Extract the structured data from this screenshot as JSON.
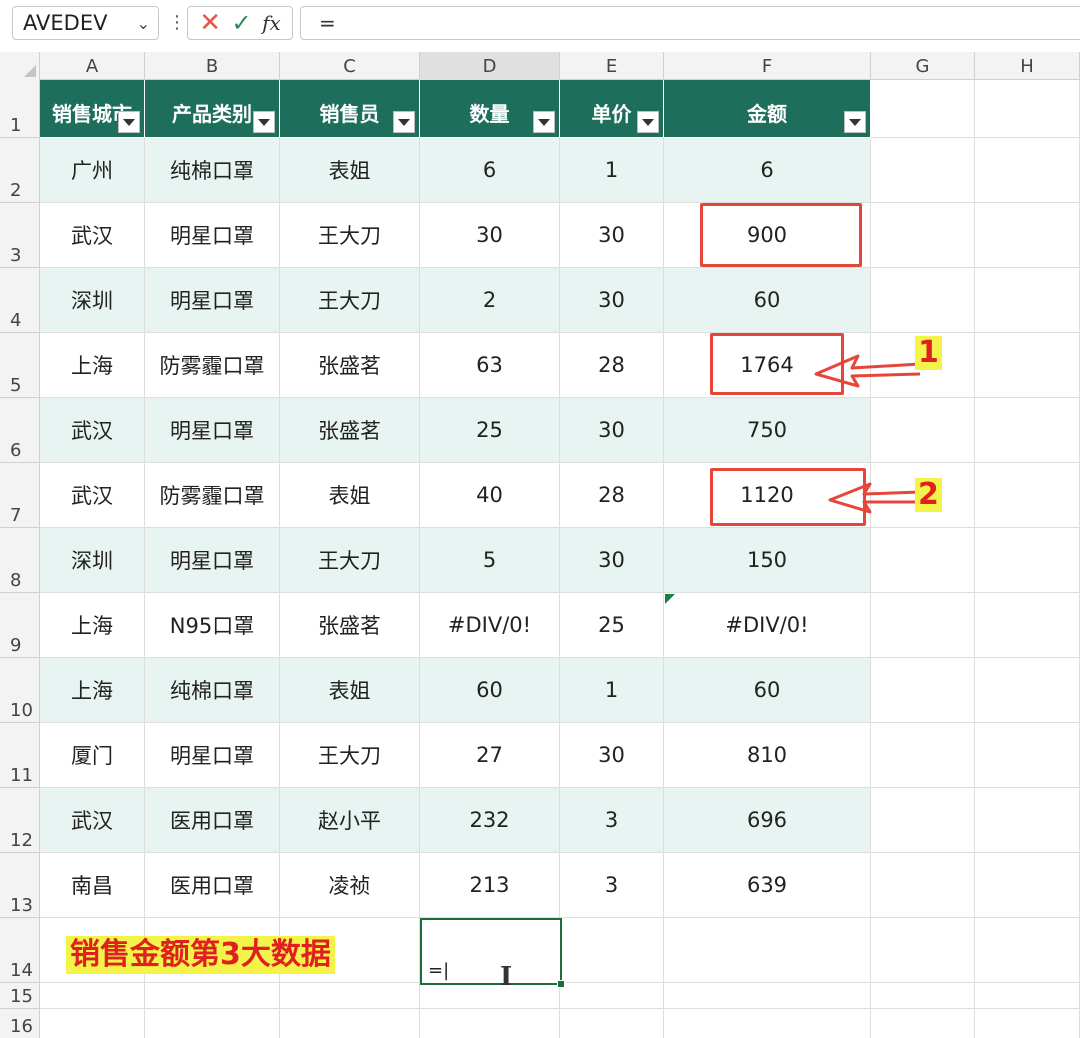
{
  "formula_bar": {
    "name_box": "AVEDEV",
    "separator": "⋮",
    "cancel_icon": "✕",
    "enter_icon": "✓",
    "fx_label": "fx",
    "formula": "="
  },
  "columns": [
    "A",
    "B",
    "C",
    "D",
    "E",
    "F",
    "G",
    "H"
  ],
  "rows": [
    "1",
    "2",
    "3",
    "4",
    "5",
    "6",
    "7",
    "8",
    "9",
    "10",
    "11",
    "12",
    "13",
    "14",
    "15",
    "16"
  ],
  "table": {
    "headers": [
      "销售城市",
      "产品类别",
      "销售员",
      "数量",
      "单价",
      "金额"
    ],
    "data": [
      [
        "广州",
        "纯棉口罩",
        "表姐",
        "6",
        "1",
        "6"
      ],
      [
        "武汉",
        "明星口罩",
        "王大刀",
        "30",
        "30",
        "900"
      ],
      [
        "深圳",
        "明星口罩",
        "王大刀",
        "2",
        "30",
        "60"
      ],
      [
        "上海",
        "防雾霾口罩",
        "张盛茗",
        "63",
        "28",
        "1764"
      ],
      [
        "武汉",
        "明星口罩",
        "张盛茗",
        "25",
        "30",
        "750"
      ],
      [
        "武汉",
        "防雾霾口罩",
        "表姐",
        "40",
        "28",
        "1120"
      ],
      [
        "深圳",
        "明星口罩",
        "王大刀",
        "5",
        "30",
        "150"
      ],
      [
        "上海",
        "N95口罩",
        "张盛茗",
        "#DIV/0!",
        "25",
        "#DIV/0!"
      ],
      [
        "上海",
        "纯棉口罩",
        "表姐",
        "60",
        "1",
        "60"
      ],
      [
        "厦门",
        "明星口罩",
        "王大刀",
        "27",
        "30",
        "810"
      ],
      [
        "武汉",
        "医用口罩",
        "赵小平",
        "232",
        "3",
        "696"
      ],
      [
        "南昌",
        "医用口罩",
        "凌祯",
        "213",
        "3",
        "639"
      ]
    ]
  },
  "annotations": {
    "tag_1": "1",
    "tag_2": "2",
    "label": "销售金额第3大数据",
    "red": "#e6463a",
    "highlight": "#f3f34a"
  },
  "active_cell": {
    "ref": "D14",
    "content": "="
  },
  "colors": {
    "header_bg": "#1e6e5c",
    "band_bg": "#e8f4f1",
    "selection": "#1e6e3c"
  }
}
